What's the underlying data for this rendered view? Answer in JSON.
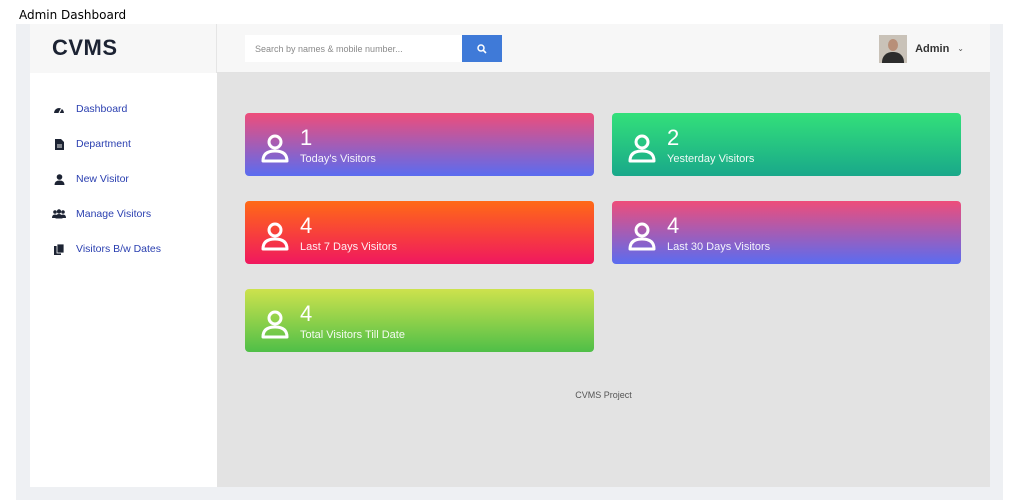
{
  "page_caption": "Admin Dashboard",
  "brand": "CVMS",
  "search": {
    "placeholder": "Search by names & mobile number..."
  },
  "user": {
    "name": "Admin"
  },
  "sidebar": {
    "items": [
      {
        "label": "Dashboard",
        "icon": "dashboard-icon"
      },
      {
        "label": "Department",
        "icon": "file-icon"
      },
      {
        "label": "New Visitor",
        "icon": "user-icon"
      },
      {
        "label": "Manage Visitors",
        "icon": "users-icon"
      },
      {
        "label": "Visitors B/w Dates",
        "icon": "copy-icon"
      }
    ]
  },
  "cards": [
    {
      "value": "1",
      "label": "Today's Visitors",
      "colors": [
        "#ee4d7a",
        "#5a6cf0"
      ]
    },
    {
      "value": "2",
      "label": "Yesterday Visitors",
      "colors": [
        "#33e07a",
        "#19a88a"
      ]
    },
    {
      "value": "4",
      "label": "Last 7 Days Visitors",
      "colors": [
        "#ff6a16",
        "#f0185f"
      ]
    },
    {
      "value": "4",
      "label": "Last 30 Days Visitors",
      "colors": [
        "#ee4d7a",
        "#5a6cf0"
      ]
    },
    {
      "value": "4",
      "label": "Total Visitors Till Date",
      "colors": [
        "#cde24d",
        "#4fbf48"
      ]
    }
  ],
  "footer": "CVMS Project",
  "colors": {
    "accent": "#3f7ad8",
    "nav_text": "#2a3fb0"
  }
}
